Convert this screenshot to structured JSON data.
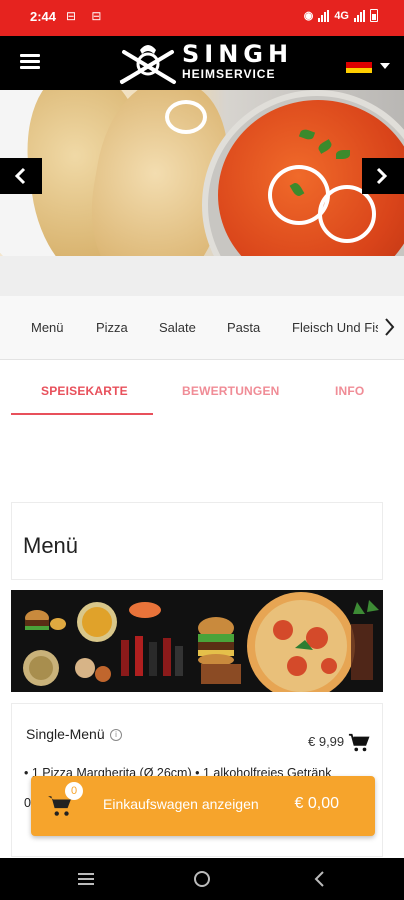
{
  "status_bar": {
    "time": "2:44",
    "left_icons": "⊟ ⊟",
    "network_label": "4G",
    "color": "#e6231f"
  },
  "header": {
    "logo_title": "SINGH",
    "logo_subtitle": "HEIMSERVICE",
    "language_flag": "germany-flag-icon",
    "background": "#000000"
  },
  "categories": [
    {
      "label": "Menü"
    },
    {
      "label": "Pizza"
    },
    {
      "label": "Salate"
    },
    {
      "label": "Pasta"
    },
    {
      "label": "Fleisch Und Fis"
    }
  ],
  "tabs": [
    {
      "label": "SPEISEKARTE",
      "active": true
    },
    {
      "label": "BEWERTUNGEN",
      "active": false
    },
    {
      "label": "INFO",
      "active": false
    }
  ],
  "accent_color": "#e8505b",
  "section": {
    "title": "Menü"
  },
  "product": {
    "name": "Single-Menü",
    "price": "€ 9,99",
    "description": "• 1 Pizza Margherita (Ø 26cm) • 1 alkoholfreies Getränk",
    "description_line2": "0"
  },
  "cart": {
    "count": "0",
    "label": "Einkaufswagen anzeigen",
    "total": "€ 0,00",
    "color": "#f6a42c"
  }
}
